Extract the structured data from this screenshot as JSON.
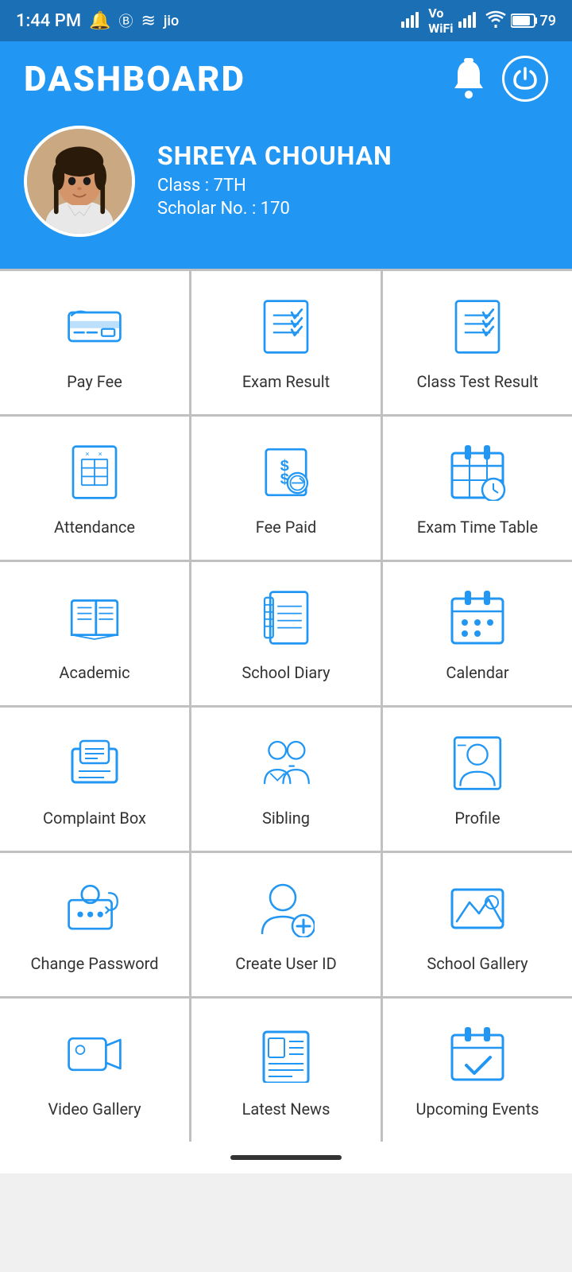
{
  "statusBar": {
    "time": "1:44 PM",
    "battery": "79"
  },
  "header": {
    "title": "DASHBOARD",
    "bellIcon": "bell-icon",
    "powerIcon": "power-icon"
  },
  "profile": {
    "name": "SHREYA  CHOUHAN",
    "class_label": "Class : 7TH",
    "scholar_label": "Scholar No. : 170"
  },
  "grid": [
    {
      "id": "pay-fee",
      "label": "Pay Fee",
      "icon": "credit-card"
    },
    {
      "id": "exam-result",
      "label": "Exam Result",
      "icon": "exam-result"
    },
    {
      "id": "class-test-result",
      "label": "Class Test Result",
      "icon": "class-test"
    },
    {
      "id": "attendance",
      "label": "Attendance",
      "icon": "attendance"
    },
    {
      "id": "fee-paid",
      "label": "Fee Paid",
      "icon": "fee-paid"
    },
    {
      "id": "exam-time-table",
      "label": "Exam Time Table",
      "icon": "timetable"
    },
    {
      "id": "academic",
      "label": "Academic",
      "icon": "academic"
    },
    {
      "id": "school-diary",
      "label": "School Diary",
      "icon": "diary"
    },
    {
      "id": "calendar",
      "label": "Calendar",
      "icon": "calendar"
    },
    {
      "id": "complaint-box",
      "label": "Complaint Box",
      "icon": "complaint"
    },
    {
      "id": "sibling",
      "label": "Sibling",
      "icon": "sibling"
    },
    {
      "id": "profile",
      "label": "Profile",
      "icon": "profile"
    },
    {
      "id": "change-password",
      "label": "Change Password",
      "icon": "change-password"
    },
    {
      "id": "create-user-id",
      "label": "Create User ID",
      "icon": "create-user"
    },
    {
      "id": "school-gallery",
      "label": "School Gallery",
      "icon": "gallery"
    },
    {
      "id": "video-gallery",
      "label": "Video Gallery",
      "icon": "video"
    },
    {
      "id": "latest-news",
      "label": "Latest News",
      "icon": "news"
    },
    {
      "id": "upcoming-events",
      "label": "Upcoming Events",
      "icon": "events"
    }
  ]
}
